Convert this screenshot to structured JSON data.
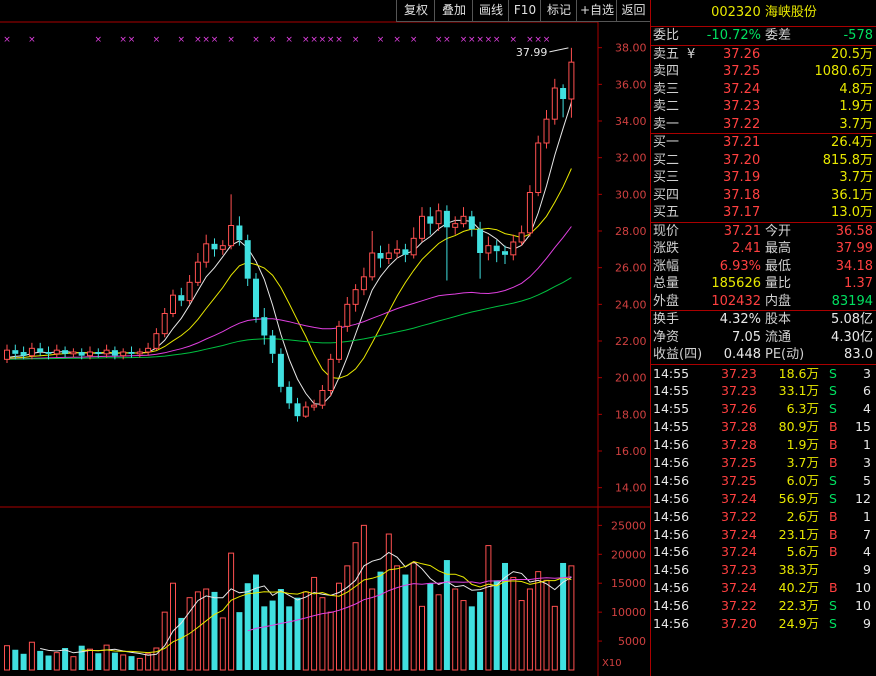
{
  "toolbar": {
    "buttons": [
      "复权",
      "叠加",
      "画线",
      "F10",
      "标记",
      "+自选",
      "返回"
    ]
  },
  "chart": {
    "price_ticks": [
      "38.00",
      "36.00",
      "34.00",
      "32.00",
      "30.00",
      "28.00",
      "26.00",
      "24.00",
      "22.00",
      "20.00",
      "18.00",
      "16.00",
      "14.00"
    ],
    "volume_ticks": [
      "25000",
      "20000",
      "15000",
      "10000",
      "5000"
    ],
    "volume_unit": "X10",
    "high_label": "37.99"
  },
  "chart_data": {
    "type": "candlestick",
    "price_ylim": [
      13.0,
      39.4
    ],
    "volume_ylim": [
      0,
      28000
    ],
    "candles": [
      [
        21.0,
        21.5,
        21.8,
        20.8
      ],
      [
        21.5,
        21.3,
        21.8,
        21.0
      ],
      [
        21.4,
        21.2,
        21.7,
        21.0
      ],
      [
        21.2,
        21.6,
        21.9,
        21.0
      ],
      [
        21.6,
        21.4,
        21.9,
        21.2
      ],
      [
        21.4,
        21.3,
        21.7,
        21.0
      ],
      [
        21.3,
        21.5,
        21.8,
        21.1
      ],
      [
        21.5,
        21.3,
        21.7,
        21.1
      ],
      [
        21.3,
        21.4,
        21.6,
        21.1
      ],
      [
        21.4,
        21.2,
        21.6,
        21.0
      ],
      [
        21.2,
        21.4,
        21.7,
        21.0
      ],
      [
        21.4,
        21.3,
        21.6,
        21.1
      ],
      [
        21.3,
        21.5,
        21.8,
        21.1
      ],
      [
        21.5,
        21.2,
        21.7,
        21.0
      ],
      [
        21.2,
        21.4,
        21.6,
        21.0
      ],
      [
        21.4,
        21.3,
        21.7,
        21.1
      ],
      [
        21.3,
        21.4,
        21.6,
        21.1
      ],
      [
        21.4,
        21.6,
        21.9,
        21.2
      ],
      [
        21.6,
        22.4,
        22.7,
        21.5
      ],
      [
        22.4,
        23.5,
        23.8,
        22.2
      ],
      [
        23.5,
        24.5,
        24.8,
        23.3
      ],
      [
        24.5,
        24.2,
        24.9,
        23.9
      ],
      [
        24.2,
        25.2,
        25.6,
        24.0
      ],
      [
        25.2,
        26.3,
        26.8,
        25.0
      ],
      [
        26.3,
        27.3,
        27.8,
        26.0
      ],
      [
        27.3,
        27.0,
        27.6,
        26.6
      ],
      [
        27.0,
        27.2,
        27.5,
        26.7
      ],
      [
        27.2,
        28.3,
        30.0,
        27.0
      ],
      [
        28.3,
        27.5,
        28.8,
        27.2
      ],
      [
        27.5,
        25.4,
        27.8,
        25.0
      ],
      [
        25.4,
        23.3,
        25.7,
        23.0
      ],
      [
        23.3,
        22.3,
        23.8,
        21.8
      ],
      [
        22.3,
        21.3,
        22.6,
        20.8
      ],
      [
        21.3,
        19.5,
        21.6,
        19.2
      ],
      [
        19.5,
        18.6,
        19.8,
        18.3
      ],
      [
        18.6,
        17.9,
        18.9,
        17.6
      ],
      [
        17.9,
        18.4,
        18.7,
        17.8
      ],
      [
        18.4,
        18.5,
        18.8,
        18.2
      ],
      [
        18.5,
        19.3,
        19.6,
        18.3
      ],
      [
        19.3,
        21.0,
        21.3,
        19.0
      ],
      [
        21.0,
        22.8,
        23.1,
        20.8
      ],
      [
        22.8,
        24.0,
        24.4,
        22.5
      ],
      [
        24.0,
        24.8,
        25.1,
        23.6
      ],
      [
        24.8,
        25.5,
        26.0,
        24.5
      ],
      [
        25.5,
        26.8,
        28.0,
        25.3
      ],
      [
        26.8,
        26.5,
        27.2,
        26.0
      ],
      [
        26.5,
        26.8,
        27.3,
        26.2
      ],
      [
        26.8,
        27.0,
        27.5,
        26.5
      ],
      [
        27.0,
        26.7,
        27.3,
        26.3
      ],
      [
        26.7,
        27.6,
        28.2,
        26.5
      ],
      [
        27.6,
        28.8,
        29.3,
        27.4
      ],
      [
        28.8,
        28.4,
        29.3,
        27.8
      ],
      [
        28.4,
        29.1,
        29.5,
        28.0
      ],
      [
        29.1,
        28.2,
        29.4,
        25.3
      ],
      [
        28.2,
        28.4,
        28.8,
        27.8
      ],
      [
        28.4,
        28.8,
        29.3,
        28.2
      ],
      [
        28.8,
        28.1,
        29.1,
        27.7
      ],
      [
        28.1,
        26.8,
        28.5,
        25.4
      ],
      [
        26.8,
        27.2,
        27.7,
        26.4
      ],
      [
        27.2,
        26.9,
        27.5,
        26.3
      ],
      [
        26.9,
        26.7,
        27.2,
        26.2
      ],
      [
        26.7,
        27.4,
        27.8,
        26.4
      ],
      [
        27.4,
        27.9,
        28.3,
        27.2
      ],
      [
        27.9,
        30.1,
        30.5,
        27.7
      ],
      [
        30.1,
        32.8,
        33.2,
        29.9
      ],
      [
        32.8,
        34.1,
        34.6,
        32.5
      ],
      [
        34.1,
        35.8,
        36.3,
        33.8
      ],
      [
        35.8,
        35.2,
        36.0,
        34.2
      ],
      [
        35.2,
        37.21,
        37.99,
        34.18
      ]
    ],
    "volumes": [
      4200,
      3500,
      2800,
      4800,
      3300,
      2500,
      3000,
      3800,
      2300,
      4200,
      3600,
      2900,
      4300,
      3000,
      2600,
      2400,
      2000,
      2800,
      3800,
      10000,
      15000,
      9000,
      12500,
      13500,
      14000,
      13500,
      9000,
      20200,
      10000,
      15000,
      16500,
      11000,
      12000,
      14000,
      11000,
      12500,
      13500,
      16000,
      12500,
      10000,
      15000,
      18000,
      22000,
      25000,
      14000,
      17000,
      23500,
      18000,
      16500,
      18500,
      11000,
      15000,
      13000,
      19000,
      14000,
      12000,
      11000,
      13500,
      21500,
      15500,
      18500,
      16000,
      12000,
      14000,
      17000,
      15500,
      11000,
      18500,
      18000
    ],
    "ma_price": [
      {
        "name": "MA5",
        "color": "#e8e8e8",
        "period": 5
      },
      {
        "name": "MA10",
        "color": "#e8e800",
        "period": 10
      },
      {
        "name": "MA30",
        "color": "#e040e0",
        "period": 30
      },
      {
        "name": "MA60",
        "color": "#00c040",
        "period": 60
      }
    ],
    "ma_volume": [
      {
        "name": "VMA5",
        "color": "#e8e8e8",
        "period": 5
      },
      {
        "name": "VMA10",
        "color": "#e8e800",
        "period": 10
      },
      {
        "name": "VMA30",
        "color": "#e040e0",
        "period": 30
      }
    ],
    "markers_x": [
      0,
      3,
      11,
      14,
      15,
      18,
      21,
      23,
      24,
      25,
      27,
      30,
      32,
      34,
      36,
      37,
      38,
      39,
      40,
      42,
      45,
      47,
      49,
      52,
      53,
      55,
      56,
      57,
      58,
      59,
      61,
      63,
      64,
      65
    ]
  },
  "panel": {
    "code": "002320",
    "name": "海峡股份",
    "weibi_label": "委比",
    "weibi": "-10.72%",
    "weicha_label": "委差",
    "weicha": "-578",
    "sell": [
      {
        "label": "卖五",
        "extra": "¥",
        "price": "37.26",
        "vol": "20.5万"
      },
      {
        "label": "卖四",
        "extra": "",
        "price": "37.25",
        "vol": "1080.6万"
      },
      {
        "label": "卖三",
        "extra": "",
        "price": "37.24",
        "vol": "4.8万"
      },
      {
        "label": "卖二",
        "extra": "",
        "price": "37.23",
        "vol": "1.9万"
      },
      {
        "label": "卖一",
        "extra": "",
        "price": "37.22",
        "vol": "3.7万"
      }
    ],
    "buy": [
      {
        "label": "买一",
        "price": "37.21",
        "vol": "26.4万"
      },
      {
        "label": "买二",
        "price": "37.20",
        "vol": "815.8万"
      },
      {
        "label": "买三",
        "price": "37.19",
        "vol": "3.7万"
      },
      {
        "label": "买四",
        "price": "37.18",
        "vol": "36.1万"
      },
      {
        "label": "买五",
        "price": "37.17",
        "vol": "13.0万"
      }
    ],
    "quote": {
      "xianjia_label": "现价",
      "xianjia": "37.21",
      "jinkai_label": "今开",
      "jinkai": "36.58",
      "zhangdie_label": "涨跌",
      "zhangdie": "2.41",
      "zuigao_label": "最高",
      "zuigao": "37.99",
      "zhangfu_label": "涨幅",
      "zhangfu": "6.93%",
      "zuidi_label": "最低",
      "zuidi": "34.18",
      "zongliang_label": "总量",
      "zongliang": "185626",
      "liangbi_label": "量比",
      "liangbi": "1.37",
      "waipan_label": "外盘",
      "waipan": "102432",
      "neipan_label": "内盘",
      "neipan": "83194"
    },
    "fund": {
      "huanshou_label": "换手",
      "huanshou": "4.32%",
      "guben_label": "股本",
      "guben": "5.08亿",
      "jingzi_label": "净资",
      "jingzi": "7.05",
      "liutong_label": "流通",
      "liutong": "4.30亿",
      "shouyi_label": "收益(四)",
      "shouyi": "0.448",
      "pe_label": "PE(动)",
      "pe": "83.0"
    },
    "ticks": [
      {
        "time": "14:55",
        "price": "37.23",
        "vol": "18.6万",
        "side": "S",
        "n": "3"
      },
      {
        "time": "14:55",
        "price": "37.23",
        "vol": "33.1万",
        "side": "S",
        "n": "6"
      },
      {
        "time": "14:55",
        "price": "37.26",
        "vol": "6.3万",
        "side": "S",
        "n": "4"
      },
      {
        "time": "14:55",
        "price": "37.28",
        "vol": "80.9万",
        "side": "B",
        "n": "15"
      },
      {
        "time": "14:56",
        "price": "37.28",
        "vol": "1.9万",
        "side": "B",
        "n": "1"
      },
      {
        "time": "14:56",
        "price": "37.25",
        "vol": "3.7万",
        "side": "B",
        "n": "3"
      },
      {
        "time": "14:56",
        "price": "37.25",
        "vol": "6.0万",
        "side": "S",
        "n": "5"
      },
      {
        "time": "14:56",
        "price": "37.24",
        "vol": "56.9万",
        "side": "S",
        "n": "12"
      },
      {
        "time": "14:56",
        "price": "37.22",
        "vol": "2.6万",
        "side": "B",
        "n": "1"
      },
      {
        "time": "14:56",
        "price": "37.24",
        "vol": "23.1万",
        "side": "B",
        "n": "7"
      },
      {
        "time": "14:56",
        "price": "37.24",
        "vol": "5.6万",
        "side": "B",
        "n": "4"
      },
      {
        "time": "14:56",
        "price": "37.23",
        "vol": "38.3万",
        "side": "",
        "n": "9"
      },
      {
        "time": "14:56",
        "price": "37.24",
        "vol": "40.2万",
        "side": "B",
        "n": "10"
      },
      {
        "time": "14:56",
        "price": "37.22",
        "vol": "22.3万",
        "side": "S",
        "n": "10"
      },
      {
        "time": "14:56",
        "price": "37.20",
        "vol": "24.9万",
        "side": "S",
        "n": "9"
      }
    ]
  }
}
